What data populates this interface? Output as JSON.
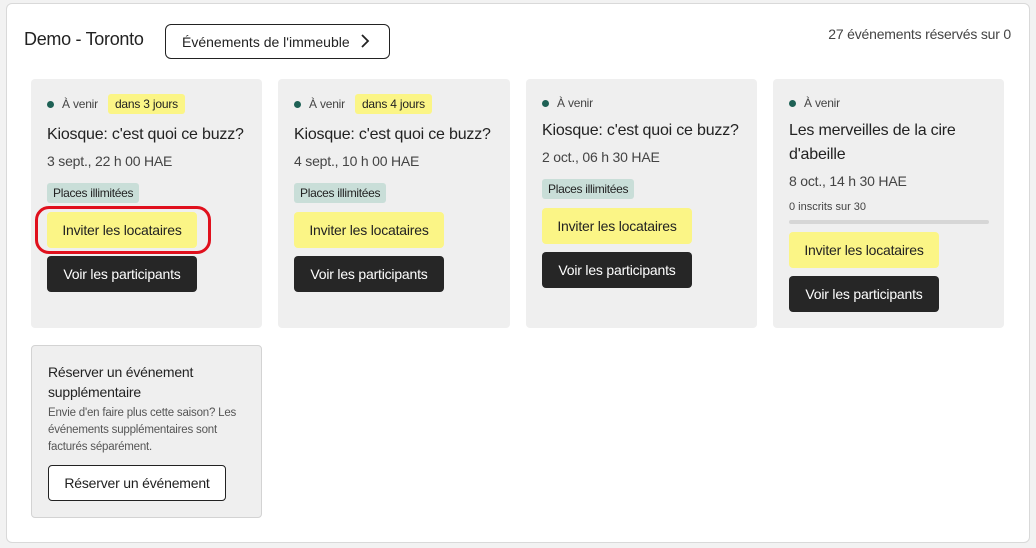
{
  "header": {
    "building_title": "Demo - Toronto",
    "events_link_label": "Événements de l'immeuble",
    "reserved_count": "27 événements réservés sur 0"
  },
  "events": [
    {
      "status": "À venir",
      "soon_badge": "dans 3 jours",
      "title": "Kiosque: c'est quoi ce buzz?",
      "date": "3 sept., 22 h 00 HAE",
      "capacity": "Places illimitées",
      "invite_label": "Inviter les locataires",
      "participants_label": "Voir les participants"
    },
    {
      "status": "À venir",
      "soon_badge": "dans 4 jours",
      "title": "Kiosque: c'est quoi ce buzz?",
      "date": "4 sept., 10 h 00 HAE",
      "capacity": "Places illimitées",
      "invite_label": "Inviter les locataires",
      "participants_label": "Voir les participants"
    },
    {
      "status": "À venir",
      "title": "Kiosque: c'est quoi ce buzz?",
      "date": "2 oct., 06 h 30 HAE",
      "capacity": "Places illimitées",
      "invite_label": "Inviter les locataires",
      "participants_label": "Voir les participants"
    },
    {
      "status": "À venir",
      "title": "Les merveilles de la cire d'abeille",
      "date": "8 oct., 14 h 30 HAE",
      "registrations": "0 inscrits sur 30",
      "registration_progress": 0,
      "invite_label": "Inviter les locataires",
      "participants_label": "Voir les participants"
    }
  ],
  "extra": {
    "title": "Réserver un événement supplémentaire",
    "description": "Envie d'en faire plus cette saison? Les événements supplémentaires sont facturés séparément.",
    "button_label": "Réserver un événement"
  },
  "colors": {
    "accent_yellow": "#fbf586",
    "dark_button": "#262626",
    "status_dot": "#1e6155",
    "capacity_badge": "#c9ded8",
    "highlight_ring": "#e0101d"
  }
}
